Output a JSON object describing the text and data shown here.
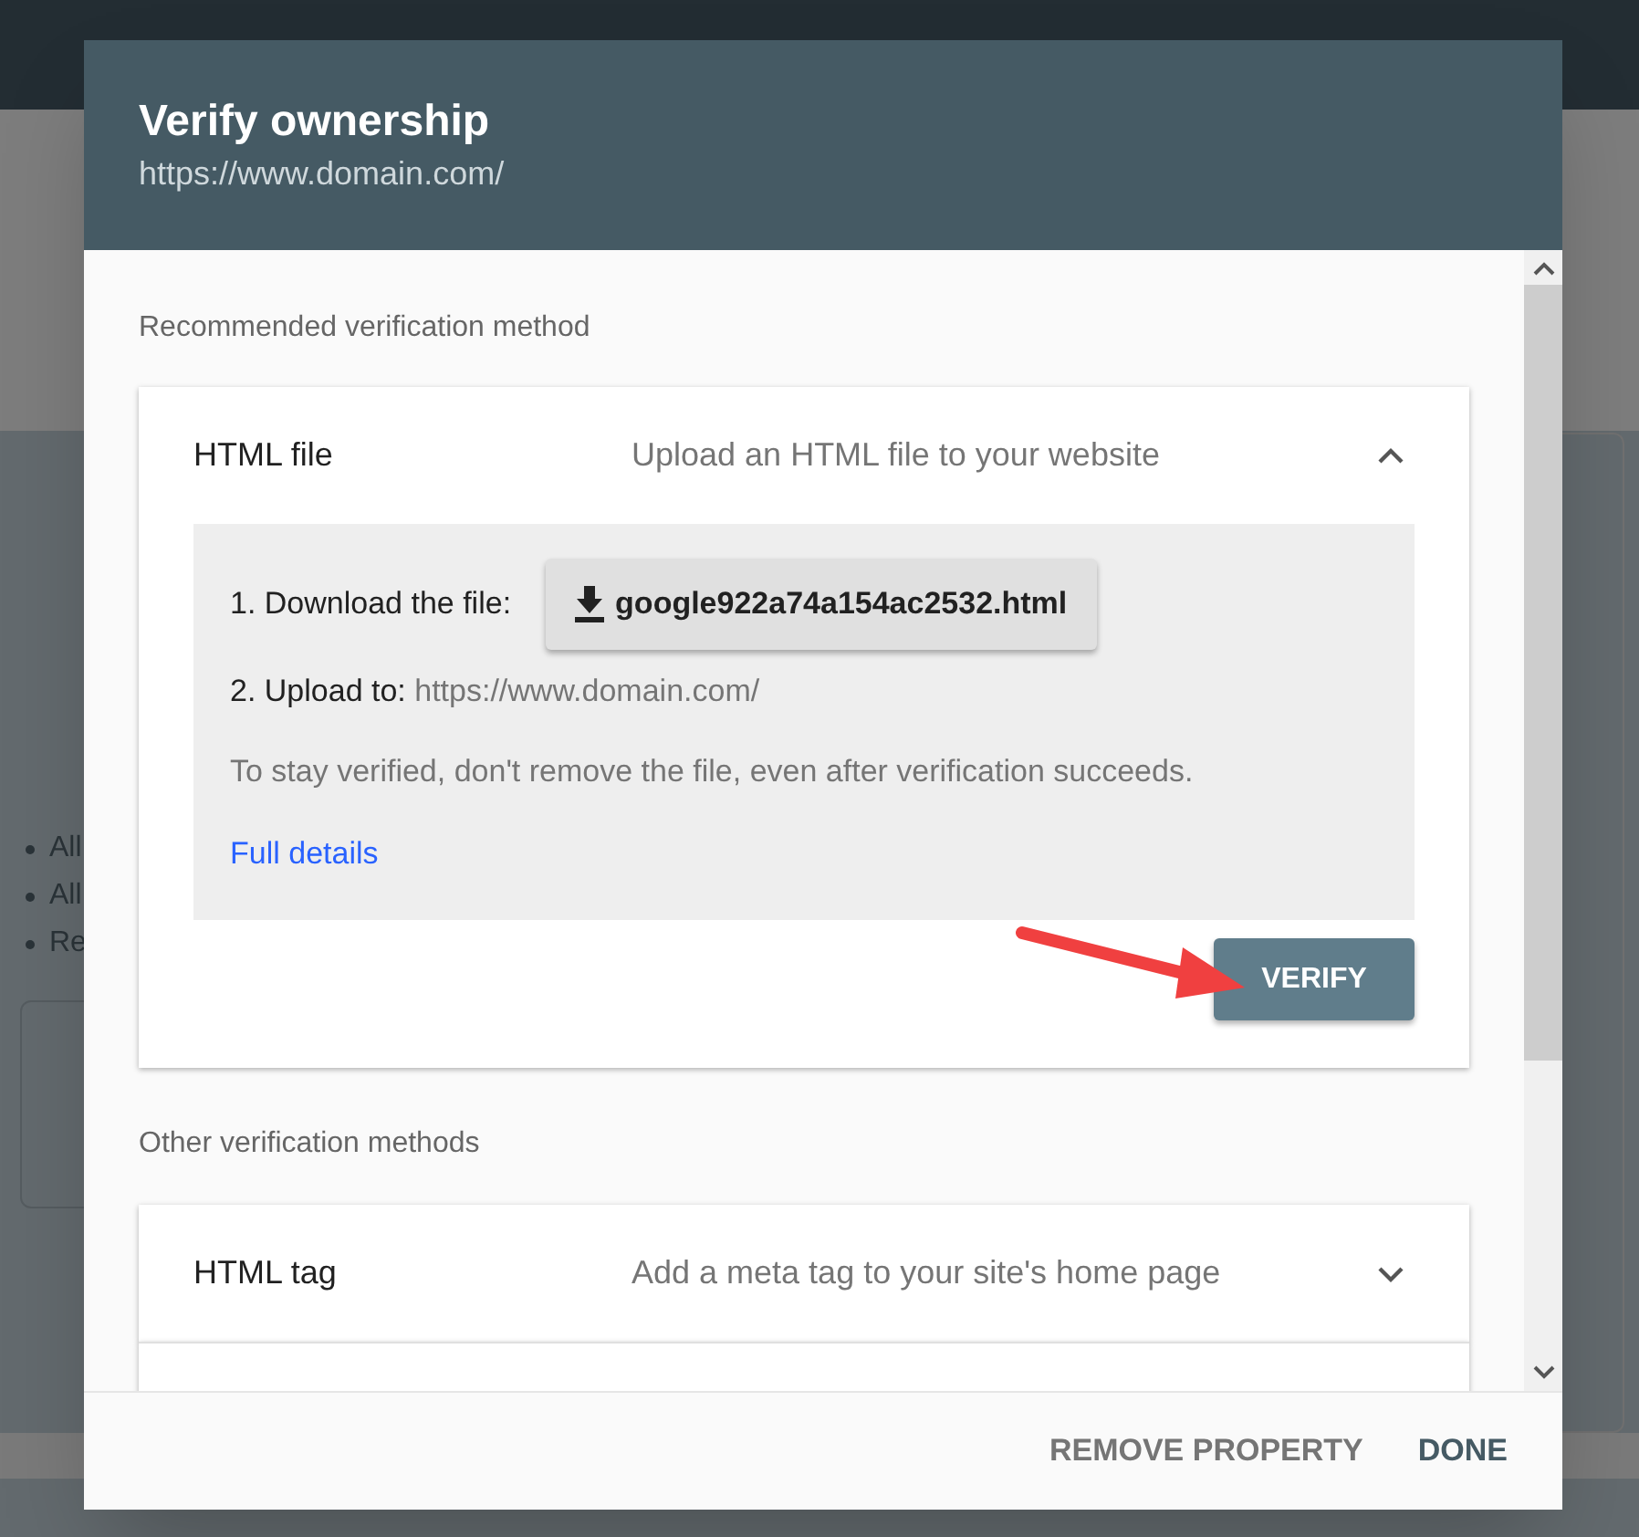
{
  "background_page": {
    "bullets": [
      "All",
      "All",
      "Re"
    ]
  },
  "dialog": {
    "title": "Verify ownership",
    "subtitle": "https://www.domain.com/",
    "sections": [
      {
        "heading": "Recommended verification method",
        "methods": [
          {
            "name": "HTML file",
            "description": "Upload an HTML file to your website",
            "expanded": true,
            "steps": [
              {
                "kind": "download",
                "label": "1. Download the file:",
                "file": "google922a74a154ac2532.html"
              },
              {
                "kind": "upload",
                "label": "2. Upload to:",
                "target": "https://www.domain.com/"
              },
              {
                "kind": "note",
                "text": "To stay verified, don't remove the file, even after verification succeeds."
              },
              {
                "kind": "link",
                "text": "Full details"
              }
            ],
            "action": "VERIFY"
          }
        ]
      },
      {
        "heading": "Other verification methods",
        "methods": [
          {
            "name": "HTML tag",
            "description": "Add a meta tag to your site's home page",
            "expanded": false
          }
        ]
      }
    ],
    "buttons": [
      "REMOVE PROPERTY",
      "DONE"
    ]
  }
}
